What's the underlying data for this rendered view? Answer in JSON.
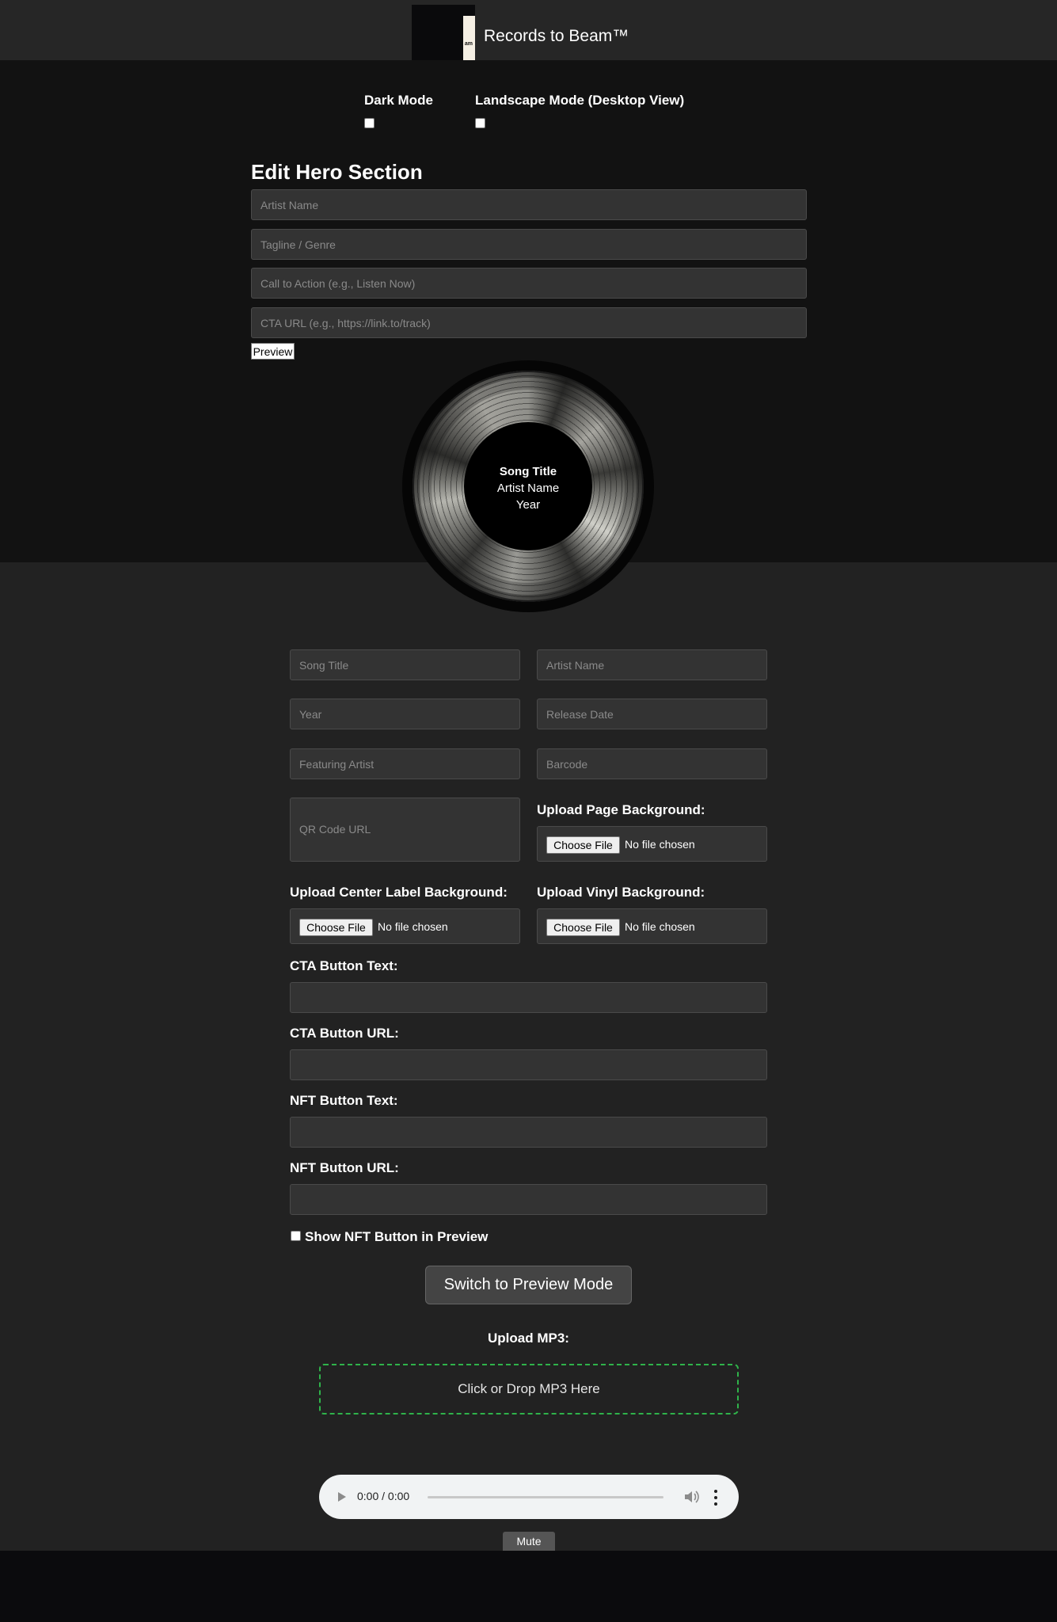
{
  "header": {
    "app_title": "Records to Beam™",
    "logo_text": "am"
  },
  "toggles": {
    "dark_mode_label": "Dark Mode",
    "landscape_mode_label": "Landscape Mode (Desktop View)"
  },
  "hero": {
    "title": "Edit Hero Section",
    "artist_placeholder": "Artist Name",
    "tagline_placeholder": "Tagline / Genre",
    "cta_placeholder": "Call to Action (e.g., Listen Now)",
    "cta_url_placeholder": "CTA URL (e.g., https://link.to/track)",
    "preview_label": "Preview"
  },
  "vinyl": {
    "song_title": "Song Title",
    "artist_name": "Artist Name",
    "year": "Year"
  },
  "release_form": {
    "song_title_placeholder": "Song Title",
    "artist_name_placeholder": "Artist Name",
    "year_placeholder": "Year",
    "release_date_placeholder": "Release Date",
    "featuring_placeholder": "Featuring Artist",
    "barcode_placeholder": "Barcode",
    "qr_placeholder": "QR Code URL",
    "page_bg_label": "Upload Page Background:",
    "center_label_bg_label": "Upload Center Label Background:",
    "vinyl_bg_label": "Upload Vinyl Background:",
    "choose_file_label": "Choose File",
    "no_file_text": "No file chosen",
    "cta_text_label": "CTA Button Text:",
    "cta_url_label": "CTA Button URL:",
    "nft_text_label": "NFT Button Text:",
    "nft_url_label": "NFT Button URL:",
    "show_nft_label": "Show NFT Button in Preview"
  },
  "actions": {
    "switch_label": "Switch to Preview Mode",
    "upload_mp3_label": "Upload MP3:",
    "dropzone_text": "Click or Drop MP3 Here"
  },
  "audio": {
    "time": "0:00 / 0:00",
    "mute_label": "Mute"
  },
  "colors": {
    "header_bg": "#262626",
    "top_panel_bg": "#121212",
    "form_bg": "#222222",
    "input_bg": "#333333",
    "dropzone_border": "#2fb34a"
  }
}
